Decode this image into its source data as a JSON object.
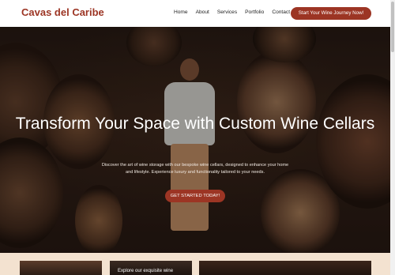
{
  "brand": {
    "name": "Cavas del Caribe"
  },
  "nav": {
    "items": [
      {
        "label": "Home"
      },
      {
        "label": "About"
      },
      {
        "label": "Services"
      },
      {
        "label": "Portfolio"
      },
      {
        "label": "Contact"
      }
    ],
    "cta_label": "Start Your Wine Journey Now!"
  },
  "hero": {
    "title": "Transform Your Space with Custom Wine Cellars",
    "subtitle": "Discover the art of wine storage with our bespoke wine cellars, designed to enhance your home and lifestyle. Experience luxury and functionality tailored to your needs.",
    "button_label": "GET STARTED TODAY!"
  },
  "cards": {
    "card2_text": "Explore our exquisite wine"
  },
  "colors": {
    "accent": "#9c3524",
    "background": "#f3e2d0"
  }
}
